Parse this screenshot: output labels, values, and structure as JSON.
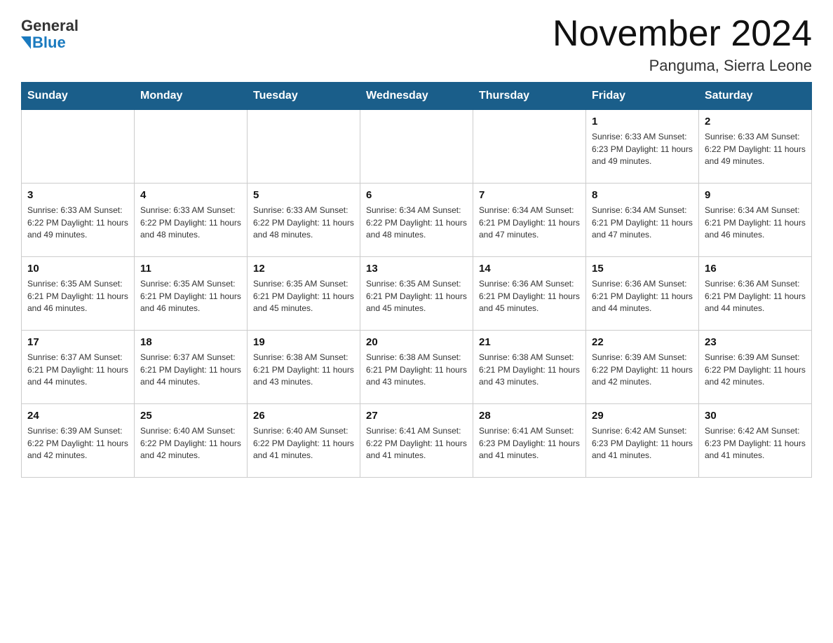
{
  "header": {
    "logo_general": "General",
    "logo_blue": "Blue",
    "month_title": "November 2024",
    "location": "Panguma, Sierra Leone"
  },
  "days_of_week": [
    "Sunday",
    "Monday",
    "Tuesday",
    "Wednesday",
    "Thursday",
    "Friday",
    "Saturday"
  ],
  "weeks": [
    {
      "days": [
        {
          "num": "",
          "info": ""
        },
        {
          "num": "",
          "info": ""
        },
        {
          "num": "",
          "info": ""
        },
        {
          "num": "",
          "info": ""
        },
        {
          "num": "",
          "info": ""
        },
        {
          "num": "1",
          "info": "Sunrise: 6:33 AM\nSunset: 6:23 PM\nDaylight: 11 hours and 49 minutes."
        },
        {
          "num": "2",
          "info": "Sunrise: 6:33 AM\nSunset: 6:22 PM\nDaylight: 11 hours and 49 minutes."
        }
      ]
    },
    {
      "days": [
        {
          "num": "3",
          "info": "Sunrise: 6:33 AM\nSunset: 6:22 PM\nDaylight: 11 hours and 49 minutes."
        },
        {
          "num": "4",
          "info": "Sunrise: 6:33 AM\nSunset: 6:22 PM\nDaylight: 11 hours and 48 minutes."
        },
        {
          "num": "5",
          "info": "Sunrise: 6:33 AM\nSunset: 6:22 PM\nDaylight: 11 hours and 48 minutes."
        },
        {
          "num": "6",
          "info": "Sunrise: 6:34 AM\nSunset: 6:22 PM\nDaylight: 11 hours and 48 minutes."
        },
        {
          "num": "7",
          "info": "Sunrise: 6:34 AM\nSunset: 6:21 PM\nDaylight: 11 hours and 47 minutes."
        },
        {
          "num": "8",
          "info": "Sunrise: 6:34 AM\nSunset: 6:21 PM\nDaylight: 11 hours and 47 minutes."
        },
        {
          "num": "9",
          "info": "Sunrise: 6:34 AM\nSunset: 6:21 PM\nDaylight: 11 hours and 46 minutes."
        }
      ]
    },
    {
      "days": [
        {
          "num": "10",
          "info": "Sunrise: 6:35 AM\nSunset: 6:21 PM\nDaylight: 11 hours and 46 minutes."
        },
        {
          "num": "11",
          "info": "Sunrise: 6:35 AM\nSunset: 6:21 PM\nDaylight: 11 hours and 46 minutes."
        },
        {
          "num": "12",
          "info": "Sunrise: 6:35 AM\nSunset: 6:21 PM\nDaylight: 11 hours and 45 minutes."
        },
        {
          "num": "13",
          "info": "Sunrise: 6:35 AM\nSunset: 6:21 PM\nDaylight: 11 hours and 45 minutes."
        },
        {
          "num": "14",
          "info": "Sunrise: 6:36 AM\nSunset: 6:21 PM\nDaylight: 11 hours and 45 minutes."
        },
        {
          "num": "15",
          "info": "Sunrise: 6:36 AM\nSunset: 6:21 PM\nDaylight: 11 hours and 44 minutes."
        },
        {
          "num": "16",
          "info": "Sunrise: 6:36 AM\nSunset: 6:21 PM\nDaylight: 11 hours and 44 minutes."
        }
      ]
    },
    {
      "days": [
        {
          "num": "17",
          "info": "Sunrise: 6:37 AM\nSunset: 6:21 PM\nDaylight: 11 hours and 44 minutes."
        },
        {
          "num": "18",
          "info": "Sunrise: 6:37 AM\nSunset: 6:21 PM\nDaylight: 11 hours and 44 minutes."
        },
        {
          "num": "19",
          "info": "Sunrise: 6:38 AM\nSunset: 6:21 PM\nDaylight: 11 hours and 43 minutes."
        },
        {
          "num": "20",
          "info": "Sunrise: 6:38 AM\nSunset: 6:21 PM\nDaylight: 11 hours and 43 minutes."
        },
        {
          "num": "21",
          "info": "Sunrise: 6:38 AM\nSunset: 6:21 PM\nDaylight: 11 hours and 43 minutes."
        },
        {
          "num": "22",
          "info": "Sunrise: 6:39 AM\nSunset: 6:22 PM\nDaylight: 11 hours and 42 minutes."
        },
        {
          "num": "23",
          "info": "Sunrise: 6:39 AM\nSunset: 6:22 PM\nDaylight: 11 hours and 42 minutes."
        }
      ]
    },
    {
      "days": [
        {
          "num": "24",
          "info": "Sunrise: 6:39 AM\nSunset: 6:22 PM\nDaylight: 11 hours and 42 minutes."
        },
        {
          "num": "25",
          "info": "Sunrise: 6:40 AM\nSunset: 6:22 PM\nDaylight: 11 hours and 42 minutes."
        },
        {
          "num": "26",
          "info": "Sunrise: 6:40 AM\nSunset: 6:22 PM\nDaylight: 11 hours and 41 minutes."
        },
        {
          "num": "27",
          "info": "Sunrise: 6:41 AM\nSunset: 6:22 PM\nDaylight: 11 hours and 41 minutes."
        },
        {
          "num": "28",
          "info": "Sunrise: 6:41 AM\nSunset: 6:23 PM\nDaylight: 11 hours and 41 minutes."
        },
        {
          "num": "29",
          "info": "Sunrise: 6:42 AM\nSunset: 6:23 PM\nDaylight: 11 hours and 41 minutes."
        },
        {
          "num": "30",
          "info": "Sunrise: 6:42 AM\nSunset: 6:23 PM\nDaylight: 11 hours and 41 minutes."
        }
      ]
    }
  ]
}
